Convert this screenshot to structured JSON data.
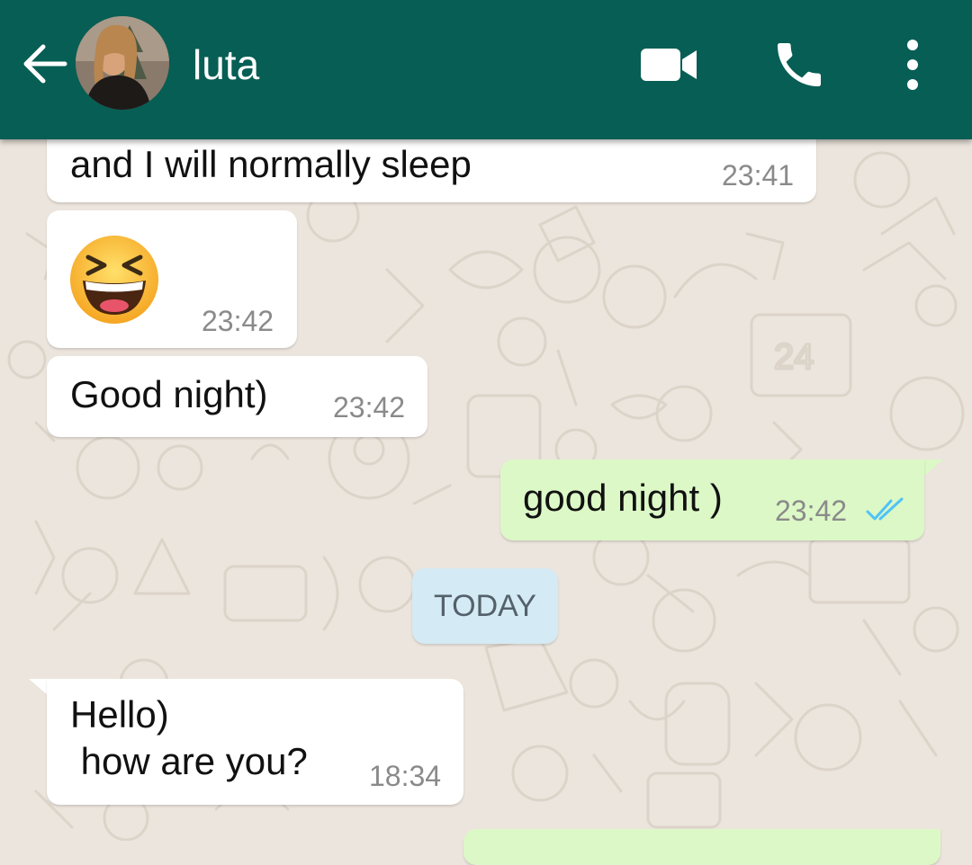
{
  "header": {
    "contact_name": "luta",
    "icons": {
      "back": "arrow-left-icon",
      "video": "video-camera-icon",
      "call": "phone-icon",
      "menu": "more-vertical-icon"
    }
  },
  "messages": [
    {
      "direction": "in",
      "text": "and I will normally sleep",
      "time": "23:41"
    },
    {
      "direction": "in",
      "text": "😆",
      "time": "23:42",
      "emoji": "grinning-squinting-face"
    },
    {
      "direction": "in",
      "text": "Good night)",
      "time": "23:42"
    },
    {
      "direction": "out",
      "text": "good night )",
      "time": "23:42",
      "status": "read"
    },
    {
      "direction": "in",
      "text": "Hello)\n how are you?",
      "time": "18:34"
    }
  ],
  "date_separator": "TODAY",
  "colors": {
    "appbar": "#075E54",
    "chat_background": "#ECE5DD",
    "incoming_bubble": "#FFFFFF",
    "outgoing_bubble": "#DCF8C6",
    "read_ticks": "#4FC3F7",
    "date_chip": "#D4EAF4"
  }
}
